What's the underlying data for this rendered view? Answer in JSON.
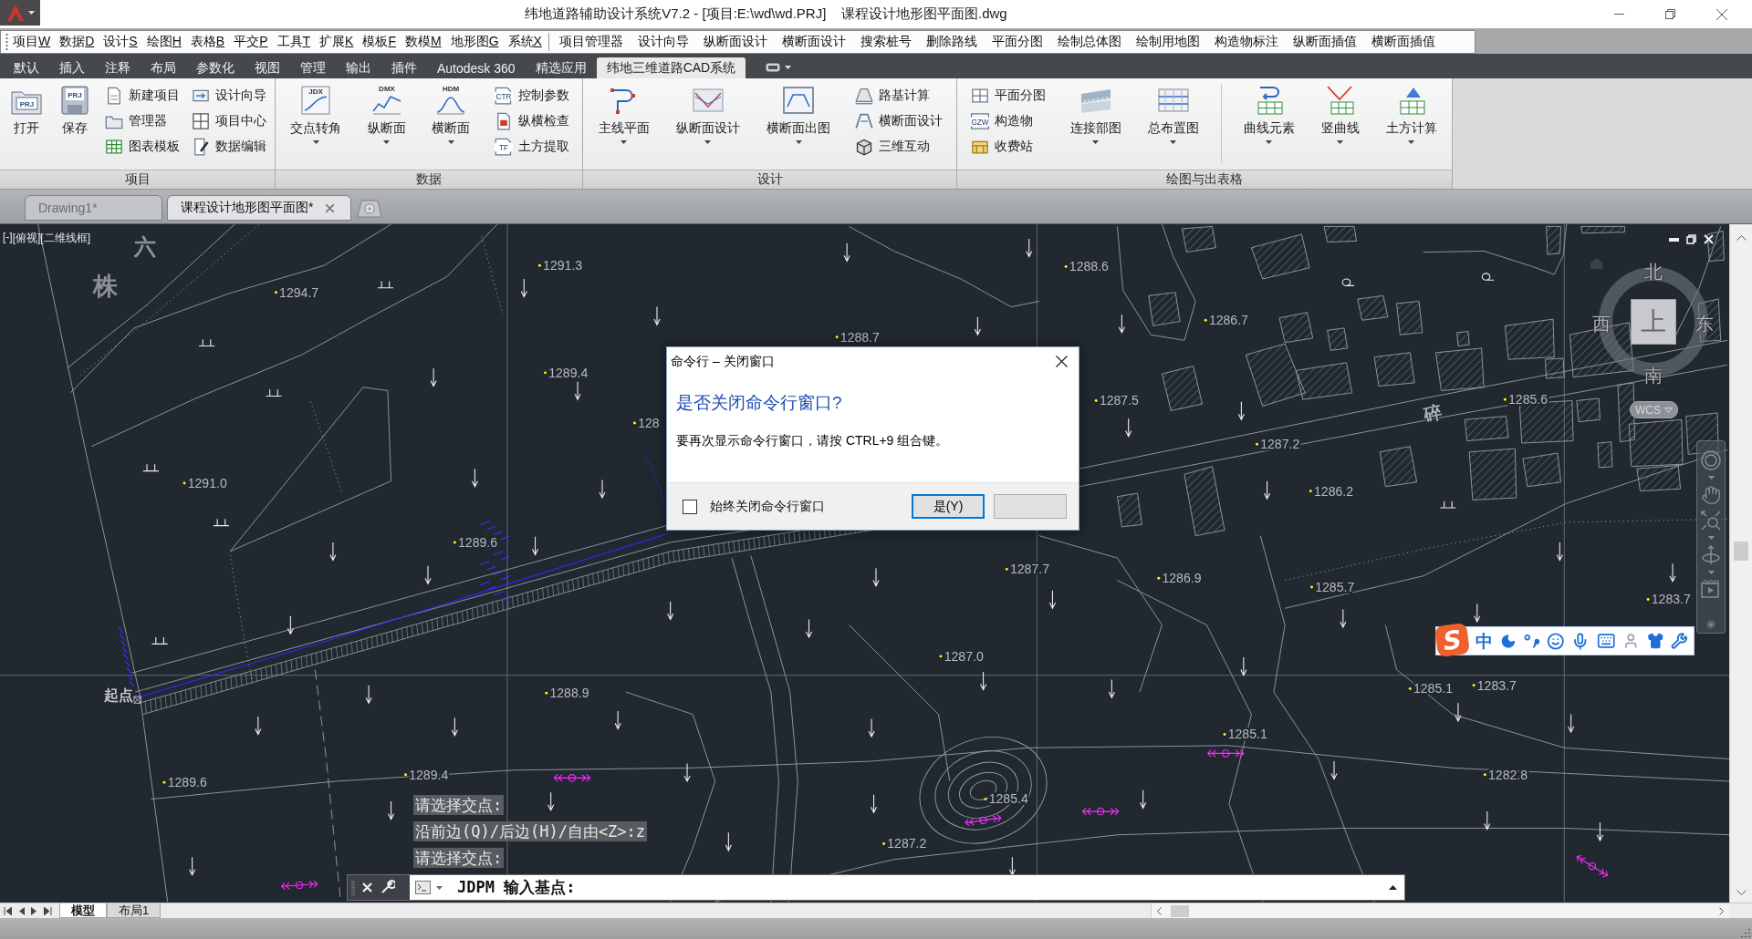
{
  "title_bar": {
    "title": "纬地道路辅助设计系统V7.2 - [项目:E:\\wd\\wd.PRJ]    课程设计地形图平面图.dwg"
  },
  "menu_bar": {
    "menus": [
      {
        "label": "项目",
        "key": "W"
      },
      {
        "label": "数据",
        "key": "D"
      },
      {
        "label": "设计",
        "key": "S"
      },
      {
        "label": "绘图",
        "key": "H"
      },
      {
        "label": "表格",
        "key": "B"
      },
      {
        "label": "平交",
        "key": "P"
      },
      {
        "label": "工具",
        "key": "T"
      },
      {
        "label": "扩展",
        "key": "K"
      },
      {
        "label": "模板",
        "key": "F"
      },
      {
        "label": "数模",
        "key": "M"
      },
      {
        "label": "地形图",
        "key": "G"
      },
      {
        "label": "系统",
        "key": "X"
      }
    ],
    "commands": [
      "项目管理器",
      "设计向导",
      "纵断面设计",
      "横断面设计",
      "搜索桩号",
      "删除路线",
      "平面分图",
      "绘制总体图",
      "绘制用地图",
      "构造物标注",
      "纵断面插值",
      "横断面插值"
    ]
  },
  "ribbon": {
    "tabs": [
      {
        "label": "默认",
        "selected": false
      },
      {
        "label": "插入",
        "selected": false
      },
      {
        "label": "注释",
        "selected": false
      },
      {
        "label": "布局",
        "selected": false
      },
      {
        "label": "参数化",
        "selected": false
      },
      {
        "label": "视图",
        "selected": false
      },
      {
        "label": "管理",
        "selected": false
      },
      {
        "label": "输出",
        "selected": false
      },
      {
        "label": "插件",
        "selected": false
      },
      {
        "label": "Autodesk 360",
        "selected": false
      },
      {
        "label": "精选应用",
        "selected": false
      },
      {
        "label": "纬地三维道路CAD系统",
        "selected": true
      }
    ],
    "panels": [
      {
        "title": "项目",
        "groups": [
          {
            "kind": "large",
            "label": "打开",
            "icon_text": "PRJ",
            "dropdown": false
          },
          {
            "kind": "large",
            "label": "保存",
            "icon_text": "PRJ",
            "dropdown": false
          },
          {
            "kind": "stack",
            "items": [
              {
                "label": "新建项目"
              },
              {
                "label": "管理器"
              },
              {
                "label": "图表模板"
              }
            ]
          },
          {
            "kind": "stack",
            "items": [
              {
                "label": "设计向导"
              },
              {
                "label": "项目中心"
              },
              {
                "label": "数据编辑"
              }
            ]
          }
        ]
      },
      {
        "title": "数据",
        "groups": [
          {
            "kind": "large",
            "label": "交点转角",
            "icon_text": "JDX",
            "dropdown": true
          },
          {
            "kind": "large",
            "label": "纵断面",
            "icon_text": "DMX",
            "dropdown": true
          },
          {
            "kind": "large",
            "label": "横断面",
            "icon_text": "HDM",
            "dropdown": true
          },
          {
            "kind": "stack",
            "items": [
              {
                "label": "控制参数",
                "icon_text": "CTR"
              },
              {
                "label": "纵横检查"
              },
              {
                "label": "土方提取",
                "icon_text": "TF"
              }
            ]
          }
        ]
      },
      {
        "title": "设计",
        "groups": [
          {
            "kind": "large",
            "label": "主线平面",
            "dropdown": true
          },
          {
            "kind": "large",
            "label": "纵断面设计",
            "dropdown": true
          },
          {
            "kind": "large",
            "label": "横断面出图",
            "dropdown": true
          },
          {
            "kind": "stack",
            "items": [
              {
                "label": "路基计算"
              },
              {
                "label": "横断面设计"
              },
              {
                "label": "三维互动"
              }
            ]
          }
        ]
      },
      {
        "title": "绘图与出表格",
        "groups": [
          {
            "kind": "stack",
            "items": [
              {
                "label": "平面分图"
              },
              {
                "label": "构造物",
                "icon_text": "GZW"
              },
              {
                "label": "收费站"
              }
            ]
          },
          {
            "kind": "large",
            "label": "连接部图",
            "dropdown": true
          },
          {
            "kind": "large",
            "label": "总布置图",
            "dropdown": true
          },
          {
            "kind": "separator"
          },
          {
            "kind": "large",
            "label": "曲线元素",
            "dropdown": true
          },
          {
            "kind": "large",
            "label": "竖曲线",
            "dropdown": true
          },
          {
            "kind": "large",
            "label": "土方计算",
            "dropdown": true
          }
        ]
      }
    ]
  },
  "file_tabs": [
    {
      "label": "Drawing1*",
      "selected": false
    },
    {
      "label": "课程设计地形图平面图*",
      "selected": true
    }
  ],
  "canvas": {
    "viewport_controls": [
      "[-]",
      "[俯视]",
      "[二维线框]"
    ],
    "map_labels": [
      "六",
      "株",
      "起点",
      "碎"
    ],
    "elevations": [
      "1294.7",
      "1291.3",
      "1288.6",
      "1288.7",
      "1286.7",
      "1289.4",
      "128",
      "1287.5",
      "1285.6",
      "1287.2",
      "1291.0",
      "1286.2",
      "1289.6",
      "1287.7",
      "1286.9",
      "1285.7",
      "1283.7",
      "1287.0",
      "1288.9",
      "1285.1",
      "1283.7",
      "1285.1",
      "1289.6",
      "1289.4",
      "1282.8",
      "1285.4",
      "1287.2"
    ],
    "viewcube": {
      "north": "北",
      "west": "西",
      "east": "东",
      "south": "南",
      "face": "上",
      "ucs": "WCS"
    },
    "ime_toolbar": {
      "logo": "S",
      "mode": "中"
    },
    "command_history": [
      "请选择交点:",
      "沿前边(Q)/后边(H)/自由<Z>:z",
      "请选择交点:"
    ],
    "command_line": {
      "prompt": "JDPM 输入基点:"
    }
  },
  "dialog": {
    "title": "命令行 – 关闭窗口",
    "heading": "是否关闭命令行窗口?",
    "message": "要再次显示命令行窗口，请按 CTRL+9 组合键。",
    "checkbox": {
      "label": "始终关闭命令行窗口",
      "checked": false
    },
    "buttons": [
      {
        "label": "是(Y)",
        "focused": true
      },
      {
        "focused": false
      }
    ]
  },
  "layout_tabs": [
    {
      "label": "模型",
      "selected": true
    },
    {
      "label": "布局1",
      "selected": false
    }
  ]
}
